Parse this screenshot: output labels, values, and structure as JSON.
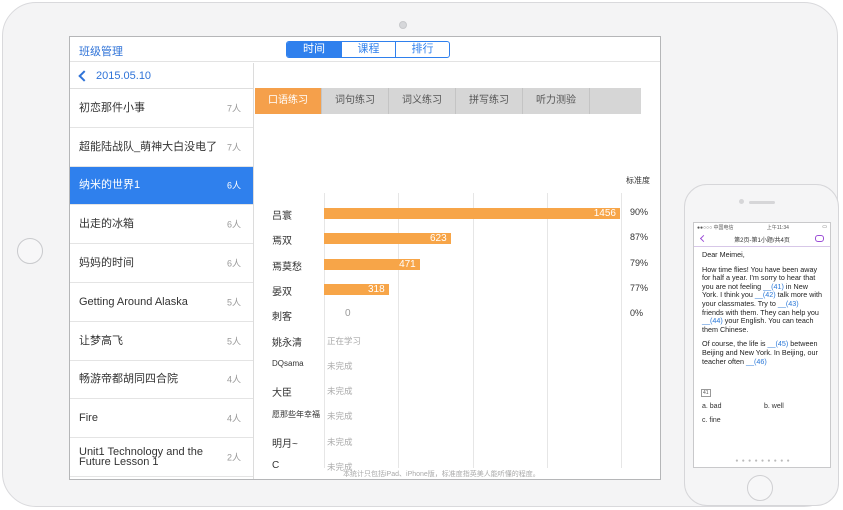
{
  "app": {
    "title": "班级管理"
  },
  "segments": [
    {
      "label": "时间",
      "active": true
    },
    {
      "label": "课程",
      "active": false
    },
    {
      "label": "排行",
      "active": false
    }
  ],
  "date": "2015.05.10",
  "lessons": [
    {
      "title": "初恋那件小事",
      "count": "7人"
    },
    {
      "title": "超能陆战队_萌神大白没电了",
      "count": "7人"
    },
    {
      "title": "纳米的世界1",
      "count": "6人",
      "selected": true
    },
    {
      "title": "出走的冰箱",
      "count": "6人"
    },
    {
      "title": "妈妈的时间",
      "count": "6人"
    },
    {
      "title": "Getting Around Alaska",
      "count": "5人"
    },
    {
      "title": "让梦高飞",
      "count": "5人"
    },
    {
      "title": "畅游帝都胡同四合院",
      "count": "4人"
    },
    {
      "title": "Fire",
      "count": "4人"
    },
    {
      "title": "Unit1 Technology and the Future  Lesson 1",
      "count": "2人"
    }
  ],
  "tabs": [
    {
      "label": "口语练习",
      "active": true
    },
    {
      "label": "词句练习"
    },
    {
      "label": "词义练习"
    },
    {
      "label": "拼写练习"
    },
    {
      "label": "听力测验"
    }
  ],
  "accuracy_header": "标准度",
  "students": [
    {
      "name": "吕寰",
      "value": 1456,
      "accuracy": "90%"
    },
    {
      "name": "焉双",
      "value": 623,
      "accuracy": "87%"
    },
    {
      "name": "焉莫愁",
      "value": 471,
      "accuracy": "79%"
    },
    {
      "name": "晏双",
      "value": 318,
      "accuracy": "77%"
    },
    {
      "name": "刺客",
      "value": 0,
      "accuracy": "0%"
    },
    {
      "name": "姚永清",
      "status": "正在学习"
    },
    {
      "name": "DQsama",
      "status": "未完成"
    },
    {
      "name": "大臣",
      "status": "未完成"
    },
    {
      "name": "愿那些年幸福",
      "status": "未完成"
    },
    {
      "name": "明月~",
      "status": "未完成"
    },
    {
      "name": "C",
      "status": "未完成"
    }
  ],
  "chart_data": {
    "type": "bar",
    "categories": [
      "吕寰",
      "焉双",
      "焉莫愁",
      "晏双",
      "刺客"
    ],
    "values": [
      1456,
      623,
      471,
      318,
      0
    ],
    "max": 1456
  },
  "footnote": "本统计只包括iPad、iPhone版，标准度指英美人能听懂的程度。",
  "phone": {
    "status_left": "●●○○○ 中国电信",
    "status_time": "上午11:34",
    "nav_title": "第2页-第1小题/共4页",
    "greeting": "Dear Meimei,",
    "paragraph1_parts": [
      "How time flies! You have been away for half a year. I'm sorry to hear that you are not feeling ",
      "__(41)",
      " in New York. I think you ",
      "__(42)",
      " talk more with your classmates. Try to ",
      "__(43)",
      " friends with them. They can help you ",
      "__(44)",
      " your English. You can teach them Chinese."
    ],
    "paragraph2_parts": [
      "Of course, the life is ",
      "__(45)",
      " between Beijing and New York. In Beijing, our teacher often ",
      "__(46)"
    ],
    "question_tag": "41",
    "options": [
      "a. bad",
      "b. well",
      "c. fine"
    ],
    "page_dots": "● ● ● ● ● ● ● ● ●"
  }
}
